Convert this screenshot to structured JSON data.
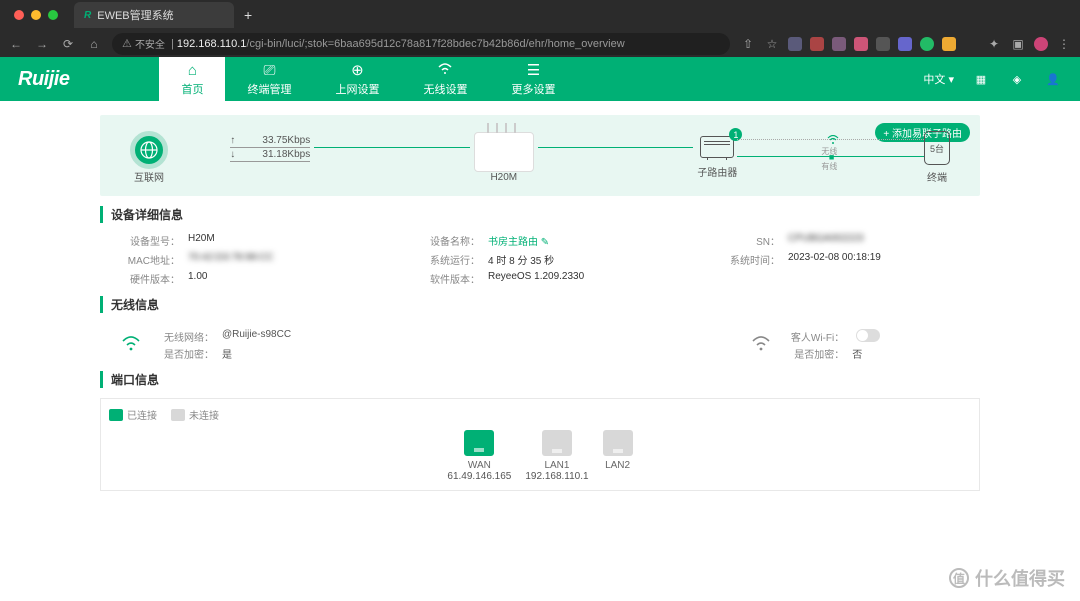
{
  "browser": {
    "tab_title": "EWEB管理系统",
    "insecure": "不安全",
    "url_ip": "192.168.110.1",
    "url_path": "/cgi-bin/luci/;stok=6baa695d12c78a817f28bdec7b42b86d/ehr/home_overview"
  },
  "header": {
    "logo": "Ruijie",
    "tabs": [
      {
        "icon": "home",
        "label": "首页"
      },
      {
        "icon": "devices",
        "label": "终端管理"
      },
      {
        "icon": "globe",
        "label": "上网设置"
      },
      {
        "icon": "wifi",
        "label": "无线设置"
      },
      {
        "icon": "more",
        "label": "更多设置"
      }
    ],
    "lang": "中文"
  },
  "topology": {
    "add_button": "添加易联子路由",
    "internet_label": "互联网",
    "up_speed": "33.75Kbps",
    "down_speed": "31.18Kbps",
    "router_name": "H20M",
    "sub_router_label": "子路由器",
    "sub_router_count": "1",
    "wireless_label": "无线",
    "wired_label": "有线",
    "terminal_label": "终端",
    "terminal_count": "5台"
  },
  "sections": {
    "device_title": "设备详细信息",
    "device": {
      "model_lab": "设备型号：",
      "model": "H20M",
      "mac_lab": "MAC地址：",
      "mac": "70:42:D3:78:98:CC",
      "hw_lab": "硬件版本：",
      "hw": "1.00",
      "name_lab": "设备名称：",
      "name": "书房主路由",
      "uptime_lab": "系统运行：",
      "uptime": "4 时 8 分 35 秒",
      "sw_lab": "软件版本：",
      "sw": "ReyeeOS 1.209.2330",
      "sn_lab": "SN：",
      "sn": "CPUBGA002223",
      "time_lab": "系统时间：",
      "time": "2023-02-08 00:18:19"
    },
    "wifi_title": "无线信息",
    "wifi": {
      "net_lab": "无线网络：",
      "net": "@Ruijie-s98CC",
      "enc_lab": "是否加密：",
      "enc": "是",
      "guest_lab": "客人Wi-Fi：",
      "guest_enc_lab": "是否加密：",
      "guest_enc": "否"
    },
    "port_title": "端口信息",
    "port": {
      "connected": "已连接",
      "disconnected": "未连接",
      "ports": [
        {
          "name": "WAN",
          "ip": "61.49.146.165",
          "on": true
        },
        {
          "name": "LAN1",
          "ip": "192.168.110.1",
          "on": false
        },
        {
          "name": "LAN2",
          "ip": "",
          "on": false
        }
      ]
    }
  },
  "watermark": "什么值得买"
}
